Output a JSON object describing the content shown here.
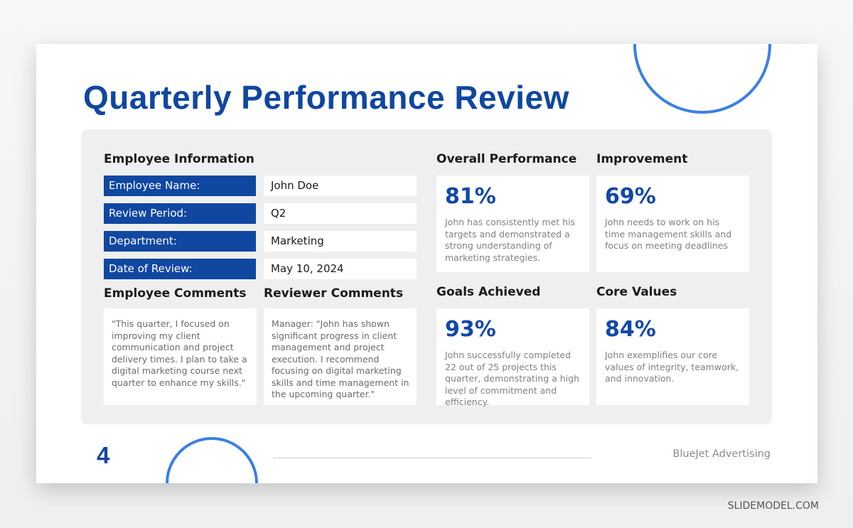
{
  "title": "Quarterly Performance Review",
  "employee_info": {
    "heading": "Employee Information",
    "rows": [
      {
        "label": "Employee Name:",
        "value": "John Doe"
      },
      {
        "label": "Review Period:",
        "value": "Q2"
      },
      {
        "label": "Department:",
        "value": "Marketing"
      },
      {
        "label": "Date of Review:",
        "value": "May 10, 2024"
      }
    ]
  },
  "comments": {
    "employee": {
      "heading": "Employee Comments",
      "text": "\"This quarter, I focused on improving my client communication and project delivery times. I plan to take a digital marketing course next quarter to enhance my skills.\""
    },
    "reviewer": {
      "heading": "Reviewer Comments",
      "text": "Manager: \"John has shown significant progress in client management and project execution. I recommend focusing on digital marketing skills and time management in the upcoming quarter.\""
    }
  },
  "metrics": [
    {
      "heading": "Overall Performance",
      "value": "81%",
      "description": "John has consistently met his targets and demonstrated a strong understanding of marketing strategies."
    },
    {
      "heading": "Improvement",
      "value": "69%",
      "description": "John needs to work on his time management skills and focus on meeting deadlines"
    },
    {
      "heading": "Goals Achieved",
      "value": "93%",
      "description": "John successfully completed 22 out of 25 projects this quarter, demonstrating a high level of commitment and efficiency."
    },
    {
      "heading": "Core Values",
      "value": "84%",
      "description": "John exemplifies our core values of integrity, teamwork, and innovation."
    }
  ],
  "footer": {
    "page_number": "4",
    "company": "BlueJet Advertising"
  },
  "watermark": "SLIDEMODEL.COM",
  "colors": {
    "primary": "#0f47a1",
    "accent_circle": "#3a80e2",
    "panel": "#efefef"
  }
}
